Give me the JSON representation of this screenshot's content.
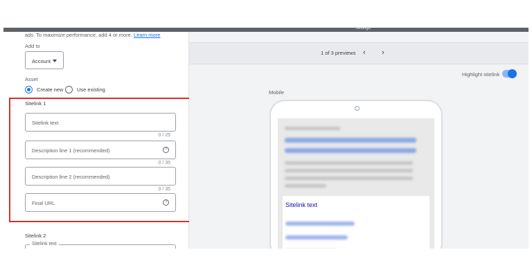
{
  "header": {
    "title": "Settings"
  },
  "left": {
    "cut_text": "ads. To maximize performance, add 4 or more.",
    "cut_link": "Learn more",
    "add_to_label": "Add to",
    "account_value": "Account",
    "asset_label": "Asset",
    "radio_create": "Create new",
    "radio_use": "Use existing",
    "sitelink1_heading": "Sitelink 1",
    "fields": [
      {
        "placeholder": "Sitelink text",
        "count": "0 / 25"
      },
      {
        "placeholder": "Description line 1 (recommended)",
        "count": "0 / 35"
      },
      {
        "placeholder": "Description line 2 (recommended)",
        "count": "0 / 35"
      },
      {
        "placeholder": "Final URL",
        "count": ""
      }
    ],
    "help_glyph": "?",
    "sitelink2_heading": "Sitelink 2",
    "sitelink2_field_label": "Sitelink text"
  },
  "preview": {
    "pager_text": "1 of 3 previews",
    "prev_arrow": "‹",
    "next_arrow": "›",
    "highlight_label": "Highlight sitelink",
    "highlight_on": true,
    "mobile_label": "Mobile",
    "sitelink_text": "Sitelink text"
  },
  "colors": {
    "accent": "#1a73e8",
    "highlight_box": "#d93025"
  }
}
